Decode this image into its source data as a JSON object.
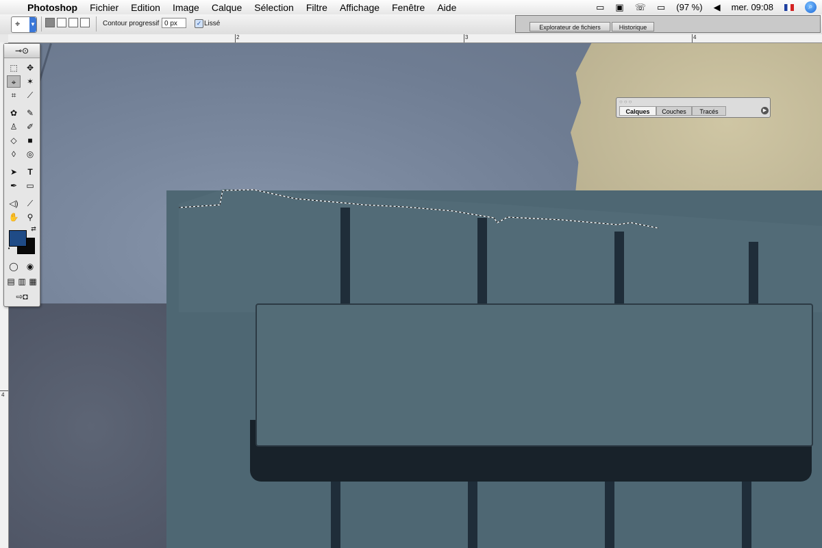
{
  "menubar": {
    "app_name": "Photoshop",
    "menus": [
      "Fichier",
      "Edition",
      "Image",
      "Calque",
      "Sélection",
      "Filtre",
      "Affichage",
      "Fenêtre",
      "Aide"
    ],
    "battery": "(97 %)",
    "clock": "mer. 09:08",
    "icons": [
      "apple-icon",
      "keyboard-icon",
      "display-icon",
      "phone-icon",
      "battery-icon",
      "volume-icon",
      "flag-icon",
      "spotlight-icon"
    ]
  },
  "options": {
    "feather_label": "Contour progressif :",
    "feather_value": "0 px",
    "antialias_label": "Lissé",
    "antialias_checked": true
  },
  "palette_well": {
    "tabs": [
      "Explorateur de fichiers",
      "Historique"
    ]
  },
  "rulers": {
    "horizontal": [
      "2",
      "3",
      "4"
    ],
    "vertical": [
      "4"
    ]
  },
  "layers_palette": {
    "tabs": [
      "Calques",
      "Couches",
      "Tracés"
    ],
    "active": "Calques"
  },
  "colors": {
    "foreground": "#1f4b86",
    "background": "#0a0a0a"
  }
}
